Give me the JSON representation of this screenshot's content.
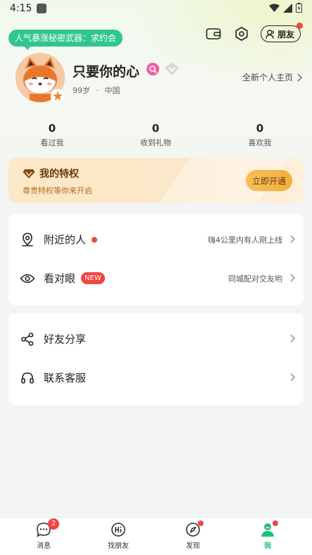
{
  "status_bar": {
    "time": "4:15"
  },
  "promo": {
    "text": "人气暴涨秘密武器：求约会"
  },
  "header": {
    "friends_label": "朋友"
  },
  "profile": {
    "name": "只要你的心",
    "age": "99岁",
    "separator": "·",
    "location": "中国",
    "homepage_link": "全新个人主页"
  },
  "stats": [
    {
      "value": "0",
      "label": "看过我"
    },
    {
      "value": "0",
      "label": "收到礼物"
    },
    {
      "value": "0",
      "label": "喜欢我"
    }
  ],
  "privilege": {
    "title": "我的特权",
    "subtitle": "尊贵特权等你来开启",
    "button": "立即开通"
  },
  "menu_group1": [
    {
      "label": "附近的人",
      "hint": "嗨4公里内有人刚上线"
    },
    {
      "label": "看对眼",
      "badge": "NEW",
      "hint": "同城配对交友哟"
    }
  ],
  "menu_group2": [
    {
      "label": "好友分享"
    },
    {
      "label": "联系客服"
    }
  ],
  "tabs": [
    {
      "label": "消息",
      "badge": "2"
    },
    {
      "label": "找朋友"
    },
    {
      "label": "发现"
    },
    {
      "label": "我"
    }
  ],
  "colors": {
    "accent_green": "#1ec27a",
    "promo_green": "#2fc78e",
    "badge_red": "#f2453d",
    "privilege_brown": "#6b3a12",
    "privilege_button": "#f3ae3e"
  }
}
